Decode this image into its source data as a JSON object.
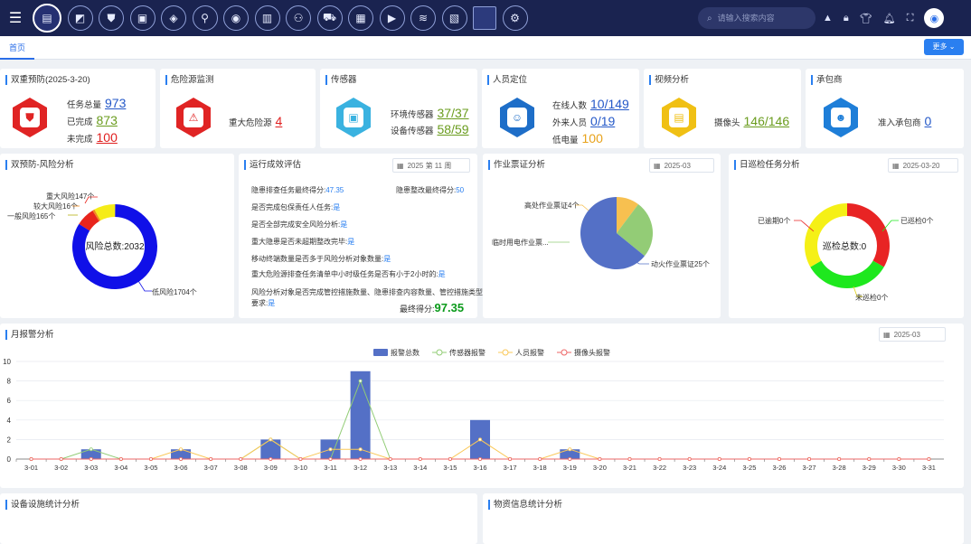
{
  "topbar": {
    "menu_icon": "hamburger-icon",
    "nav_icons": [
      "document-icon",
      "map-icon",
      "shield-icon",
      "board-icon",
      "location-icon",
      "pin-icon",
      "camera-icon",
      "book-icon",
      "people-icon",
      "truck-icon",
      "building-icon",
      "video-icon",
      "wind-icon",
      "chart-icon",
      "blank-square",
      "gear-icon"
    ],
    "search_placeholder": "请输入搜索内容",
    "right_icons": [
      "warning-icon",
      "lock-icon",
      "shirt-icon",
      "bell-icon",
      "fullscreen-icon",
      "user-avatar-icon"
    ]
  },
  "tabs": {
    "home": "首页",
    "more_label": "更多"
  },
  "cards": {
    "dual_prevention": {
      "title": "双重预防(2025-3-20)",
      "total_label": "任务总量",
      "total": "973",
      "done_label": "已完成",
      "done": "873",
      "undone_label": "未完成",
      "undone": "100"
    },
    "hazard": {
      "title": "危险源监测",
      "major_label": "重大危险源",
      "major": "4"
    },
    "sensor": {
      "title": "传感器",
      "env_label": "环境传感器",
      "env_a": "37",
      "env_b": "37",
      "dev_label": "设备传感器",
      "dev_a": "58",
      "dev_b": "59"
    },
    "people": {
      "title": "人员定位",
      "online_label": "在线人数",
      "online_a": "10",
      "online_b": "149",
      "visitor_label": "外来人员",
      "visitor_a": "0",
      "visitor_b": "19",
      "battery_label": "低电量",
      "battery": "100"
    },
    "video": {
      "title": "视频分析",
      "cam_label": "摄像头",
      "cam_a": "146",
      "cam_b": "146"
    },
    "contractor": {
      "title": "承包商",
      "admit_label": "准入承包商",
      "admit": "0"
    }
  },
  "risk": {
    "title": "双预防-风险分析",
    "center_label": "风险总数:2032",
    "labels": [
      "重大风险147个",
      "较大风险16个",
      "一般风险165个",
      "低风险1704个"
    ]
  },
  "eval": {
    "title": "运行成效评估",
    "date": "2025 第 11 周",
    "line1_label": "隐患排查任务最终得分:",
    "line1_value": "47.35",
    "line1b_label": "隐患整改最终得分:",
    "line1b_value": "50",
    "items": [
      {
        "label": "是否完成包保责任人任务:",
        "value": "是"
      },
      {
        "label": "是否全部完成安全风险分析:",
        "value": "是"
      },
      {
        "label": "重大隐患是否未超期整改完毕:",
        "value": "是"
      },
      {
        "label": "移动终端数量是否多于风险分析对象数量:",
        "value": "是"
      },
      {
        "label": "重大危险源排查任务清单中小时级任务是否有小于2小时的:",
        "value": "是"
      }
    ],
    "last_label_1": "风险分析对象是否完成管控措施数量、隐患排查内容数量、管控措施类型",
    "last_label_2": "要求:",
    "last_value": "是",
    "final_label": "最终得分:",
    "final_value": "97.35"
  },
  "work_ticket": {
    "title": "作业票证分析",
    "date": "2025-03",
    "labels": [
      "高处作业票证4个",
      "临时用电作业票...",
      "动火作业票证25个"
    ]
  },
  "patrol": {
    "title": "日巡检任务分析",
    "date": "2025-03-20",
    "center_label": "巡检总数:0",
    "labels": [
      "已逾期0个",
      "已巡检0个",
      "未巡检0个"
    ]
  },
  "monthly": {
    "title": "月报警分析",
    "date": "2025-03"
  },
  "bottom": {
    "equip_title": "设备设施统计分析",
    "material_title": "物资信息统计分析"
  },
  "colors": {
    "accent": "#2a7ff0",
    "navbar": "#1a2350"
  },
  "chart_data": [
    {
      "type": "pie",
      "title": "双预防-风险分析",
      "categories": [
        "重大风险",
        "较大风险",
        "一般风险",
        "低风险"
      ],
      "values": [
        147,
        16,
        165,
        1704
      ],
      "colors": [
        "#e8241c",
        "#f08a1c",
        "#f5ec18",
        "#1010e8"
      ]
    },
    {
      "type": "pie",
      "title": "作业票证分析",
      "categories": [
        "高处作业票证",
        "临时用电作业票证",
        "动火作业票证"
      ],
      "values": [
        4,
        10,
        25
      ],
      "colors": [
        "#f7c050",
        "#93cc76",
        "#5470c6"
      ]
    },
    {
      "type": "pie",
      "title": "日巡检任务分析",
      "categories": [
        "已逾期",
        "已巡检",
        "未巡检"
      ],
      "values": [
        1,
        1,
        1
      ],
      "colors": [
        "#e82424",
        "#1ee81e",
        "#f5f016"
      ]
    },
    {
      "type": "bar",
      "title": "月报警分析",
      "categories": [
        "3-01",
        "3-02",
        "3-03",
        "3-04",
        "3-05",
        "3-06",
        "3-07",
        "3-08",
        "3-09",
        "3-10",
        "3-11",
        "3-12",
        "3-13",
        "3-14",
        "3-15",
        "3-16",
        "3-17",
        "3-18",
        "3-19",
        "3-20",
        "3-21",
        "3-22",
        "3-23",
        "3-24",
        "3-25",
        "3-26",
        "3-27",
        "3-28",
        "3-29",
        "3-30",
        "3-31"
      ],
      "ylim": [
        0,
        10
      ],
      "yticks": [
        0,
        2,
        4,
        6,
        8,
        10
      ],
      "series": [
        {
          "name": "报警总数",
          "kind": "bar",
          "color": "#5470c6",
          "values": [
            0,
            0,
            1,
            0,
            0,
            1,
            0,
            0,
            2,
            0,
            2,
            9,
            0,
            0,
            0,
            4,
            0,
            0,
            1,
            0,
            0,
            0,
            0,
            0,
            0,
            0,
            0,
            0,
            0,
            0,
            0
          ]
        },
        {
          "name": "传感器报警",
          "kind": "line",
          "color": "#91cc75",
          "values": [
            0,
            0,
            1,
            0,
            0,
            0,
            0,
            0,
            2,
            0,
            0,
            8,
            0,
            0,
            0,
            0,
            0,
            0,
            0,
            0,
            0,
            0,
            0,
            0,
            0,
            0,
            0,
            0,
            0,
            0,
            0
          ]
        },
        {
          "name": "人员报警",
          "kind": "line",
          "color": "#fac858",
          "values": [
            0,
            0,
            0,
            0,
            0,
            1,
            0,
            0,
            2,
            0,
            1,
            1,
            0,
            0,
            0,
            2,
            0,
            0,
            1,
            0,
            0,
            0,
            0,
            0,
            0,
            0,
            0,
            0,
            0,
            0,
            0
          ]
        },
        {
          "name": "摄像头报警",
          "kind": "line",
          "color": "#ee6666",
          "values": [
            0,
            0,
            0,
            0,
            0,
            0,
            0,
            0,
            0,
            0,
            0,
            0,
            0,
            0,
            0,
            0,
            0,
            0,
            0,
            0,
            0,
            0,
            0,
            0,
            0,
            0,
            0,
            0,
            0,
            0,
            0
          ]
        }
      ]
    }
  ]
}
